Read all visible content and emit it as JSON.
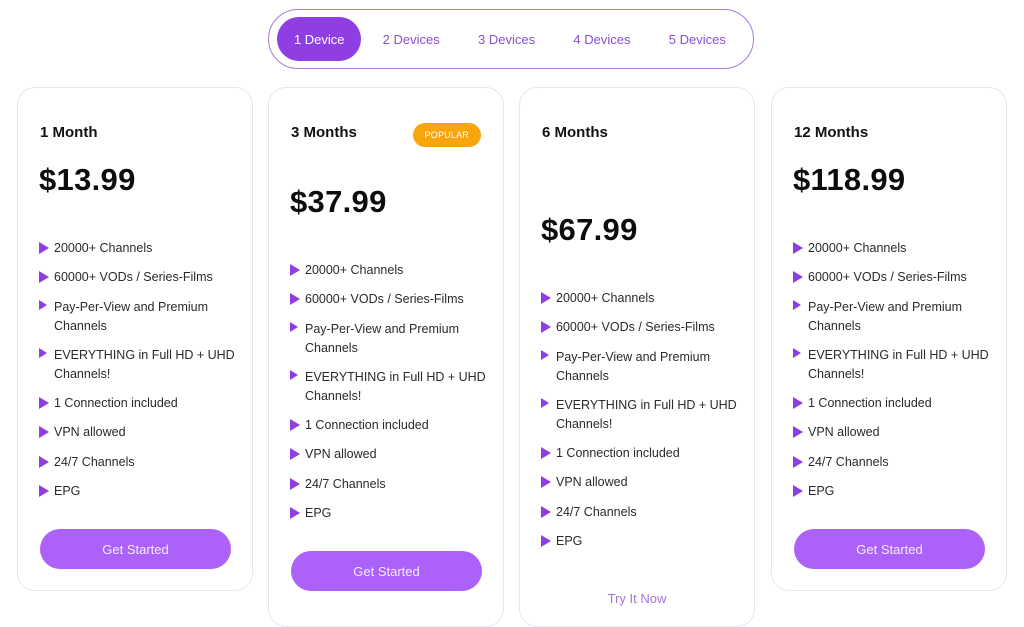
{
  "device_switch": {
    "tabs": [
      {
        "label": "1 Device",
        "active": true
      },
      {
        "label": "2 Devices",
        "active": false
      },
      {
        "label": "3 Devices",
        "active": false
      },
      {
        "label": "4 Devices",
        "active": false
      },
      {
        "label": "5 Devices",
        "active": false
      }
    ]
  },
  "colors": {
    "accent": "#8e3ee2",
    "button": "#ac62f8",
    "badge": "#f9a50e",
    "link": "#a474d8"
  },
  "plans": [
    {
      "title": "1 Month",
      "price": "$13.99",
      "badge": null,
      "features": [
        "20000+ Channels",
        "60000+ VODs / Series-Films",
        "Pay-Per-View and Premium Channels",
        "EVERYTHING in Full HD + UHD Channels!",
        "1 Connection included",
        "VPN allowed",
        "24/7 Channels",
        "EPG"
      ],
      "cta": "Get Started"
    },
    {
      "title": "3 Months",
      "price": "$37.99",
      "badge": "POPULAR",
      "features": [
        "20000+ Channels",
        "60000+ VODs / Series-Films",
        "Pay-Per-View and Premium Channels",
        "EVERYTHING in Full HD + UHD Channels!",
        "1 Connection included",
        "VPN allowed",
        "24/7 Channels",
        "EPG"
      ],
      "cta": "Get Started"
    },
    {
      "title": "6 Months",
      "price": "$67.99",
      "badge": null,
      "features": [
        "20000+ Channels",
        "60000+ VODs / Series-Films",
        "Pay-Per-View and Premium Channels",
        "EVERYTHING in Full HD + UHD Channels!",
        "1 Connection included",
        "VPN allowed",
        "24/7 Channels",
        "EPG"
      ],
      "cta": "Try It Now"
    },
    {
      "title": "12 Months",
      "price": "$118.99",
      "badge": null,
      "features": [
        "20000+ Channels",
        "60000+ VODs / Series-Films",
        "Pay-Per-View and Premium Channels",
        "EVERYTHING in Full HD + UHD Channels!",
        "1 Connection included",
        "VPN allowed",
        "24/7 Channels",
        "EPG"
      ],
      "cta": "Get Started"
    }
  ]
}
